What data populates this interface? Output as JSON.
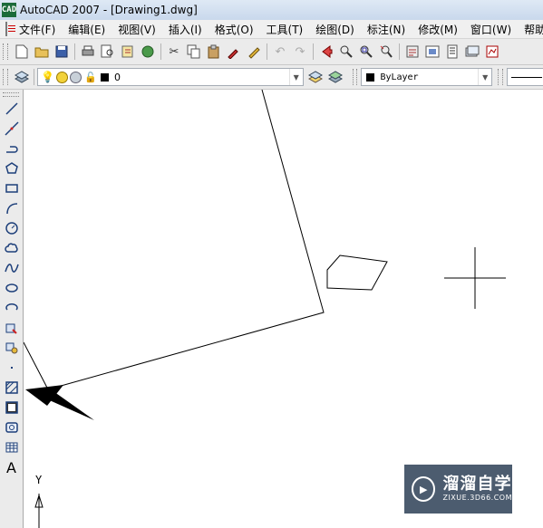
{
  "window": {
    "title": "AutoCAD 2007 - [Drawing1.dwg]",
    "app_icon": "CAD"
  },
  "menu": {
    "items": [
      "文件(F)",
      "编辑(E)",
      "视图(V)",
      "插入(I)",
      "格式(O)",
      "工具(T)",
      "绘图(D)",
      "标注(N)",
      "修改(M)",
      "窗口(W)",
      "帮助"
    ]
  },
  "standard_toolbar": {
    "icons": [
      "new-icon",
      "open-icon",
      "save-icon",
      "plot-icon",
      "plot-preview-icon",
      "publish-icon",
      "3d-dwf-icon",
      "cut-icon",
      "copy-icon",
      "paste-icon",
      "match-properties-icon",
      "block-editor-icon",
      "undo-icon",
      "redo-icon",
      "pan-icon",
      "zoom-realtime-icon",
      "zoom-window-icon",
      "zoom-previous-icon",
      "properties-icon",
      "design-center-icon",
      "tool-palettes-icon",
      "sheet-set-icon",
      "markup-icon"
    ]
  },
  "layers_toolbar": {
    "layer_name": "0",
    "color_value": "ByLayer"
  },
  "draw_toolbar": {
    "tools": [
      "line",
      "construction-line",
      "polyline",
      "polygon",
      "rectangle",
      "arc",
      "circle",
      "revision-cloud",
      "spline",
      "ellipse",
      "ellipse-arc",
      "insert-block",
      "make-block",
      "point",
      "hatch",
      "gradient",
      "region",
      "table",
      "multiline-text"
    ],
    "text_tool_label": "A"
  },
  "ucs": {
    "y_label": "Y"
  },
  "watermark": {
    "title": "溜溜自学",
    "url": "ZIXUE.3D66.COM",
    "logo_glyph": "▶"
  }
}
